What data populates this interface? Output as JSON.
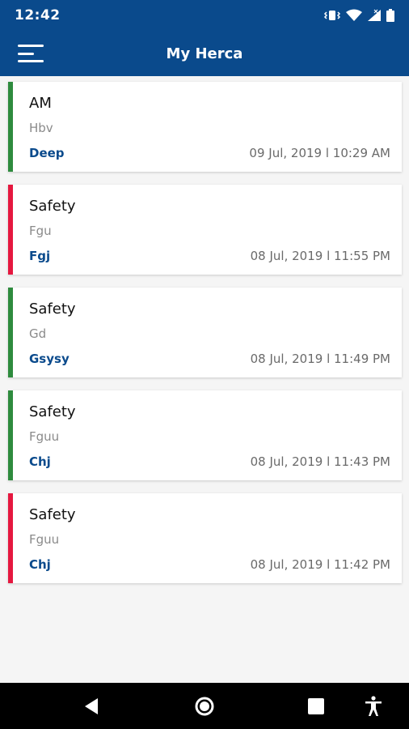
{
  "status_bar": {
    "time": "12:42",
    "icons": [
      "vibrate-icon",
      "wifi-icon",
      "signal-icon",
      "battery-icon"
    ]
  },
  "app_bar": {
    "title": "My Herca",
    "menu_icon": "hamburger-menu-icon"
  },
  "colors": {
    "primary": "#0a4a8c",
    "green_status": "#2e8b3e",
    "red_status": "#e5173f"
  },
  "items": [
    {
      "title": "AM",
      "subtitle": "Hbv",
      "user": "Deep",
      "timestamp": "09 Jul, 2019 l 10:29 AM",
      "status_color": "green"
    },
    {
      "title": "Safety",
      "subtitle": "Fgu",
      "user": "Fgj",
      "timestamp": "08 Jul, 2019 l 11:55 PM",
      "status_color": "red"
    },
    {
      "title": "Safety",
      "subtitle": "Gd",
      "user": "Gsysy",
      "timestamp": "08 Jul, 2019 l 11:49 PM",
      "status_color": "green"
    },
    {
      "title": "Safety",
      "subtitle": "Fguu",
      "user": "Chj",
      "timestamp": "08 Jul, 2019 l 11:43 PM",
      "status_color": "green"
    },
    {
      "title": "Safety",
      "subtitle": "Fguu",
      "user": "Chj",
      "timestamp": "08 Jul, 2019 l 11:42 PM",
      "status_color": "red"
    }
  ],
  "nav_bar": {
    "buttons": [
      "back-icon",
      "home-icon",
      "recents-icon",
      "accessibility-icon"
    ]
  }
}
